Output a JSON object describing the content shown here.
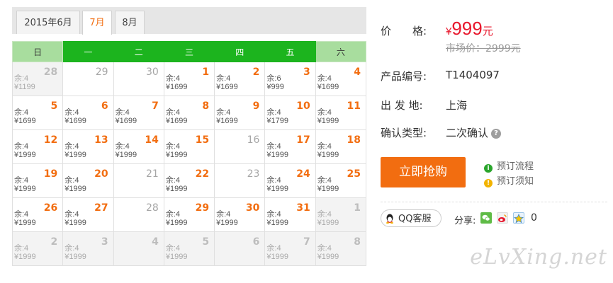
{
  "tabs": [
    "2015年6月",
    "7月",
    "8月"
  ],
  "weekdays": [
    "日",
    "一",
    "二",
    "三",
    "四",
    "五",
    "六"
  ],
  "weeks": [
    [
      {
        "day": "28",
        "rem": "余:4",
        "price": "¥1199",
        "state": "off"
      },
      {
        "day": "29",
        "rem": "",
        "price": "",
        "state": "sold"
      },
      {
        "day": "30",
        "rem": "",
        "price": "",
        "state": "sold"
      },
      {
        "day": "1",
        "rem": "余:4",
        "price": "¥1699",
        "state": "on"
      },
      {
        "day": "2",
        "rem": "余:4",
        "price": "¥1699",
        "state": "on"
      },
      {
        "day": "3",
        "rem": "余:6",
        "price": "¥999",
        "state": "on"
      },
      {
        "day": "4",
        "rem": "余:4",
        "price": "¥1699",
        "state": "on"
      }
    ],
    [
      {
        "day": "5",
        "rem": "余:4",
        "price": "¥1699",
        "state": "on"
      },
      {
        "day": "6",
        "rem": "余:4",
        "price": "¥1699",
        "state": "on"
      },
      {
        "day": "7",
        "rem": "余:4",
        "price": "¥1699",
        "state": "on"
      },
      {
        "day": "8",
        "rem": "余:4",
        "price": "¥1699",
        "state": "on"
      },
      {
        "day": "9",
        "rem": "余:4",
        "price": "¥1699",
        "state": "on"
      },
      {
        "day": "10",
        "rem": "余:4",
        "price": "¥1799",
        "state": "on"
      },
      {
        "day": "11",
        "rem": "余:4",
        "price": "¥1999",
        "state": "on"
      }
    ],
    [
      {
        "day": "12",
        "rem": "余:4",
        "price": "¥1999",
        "state": "on"
      },
      {
        "day": "13",
        "rem": "余:4",
        "price": "¥1999",
        "state": "on"
      },
      {
        "day": "14",
        "rem": "余:4",
        "price": "¥1999",
        "state": "on"
      },
      {
        "day": "15",
        "rem": "余:4",
        "price": "¥1999",
        "state": "on"
      },
      {
        "day": "16",
        "rem": "",
        "price": "",
        "state": "sold"
      },
      {
        "day": "17",
        "rem": "余:4",
        "price": "¥1999",
        "state": "on"
      },
      {
        "day": "18",
        "rem": "余:4",
        "price": "¥1999",
        "state": "on"
      }
    ],
    [
      {
        "day": "19",
        "rem": "余:4",
        "price": "¥1999",
        "state": "on"
      },
      {
        "day": "20",
        "rem": "余:4",
        "price": "¥1999",
        "state": "on"
      },
      {
        "day": "21",
        "rem": "",
        "price": "",
        "state": "sold"
      },
      {
        "day": "22",
        "rem": "余:4",
        "price": "¥1999",
        "state": "on"
      },
      {
        "day": "23",
        "rem": "",
        "price": "",
        "state": "sold"
      },
      {
        "day": "24",
        "rem": "余:4",
        "price": "¥1999",
        "state": "on"
      },
      {
        "day": "25",
        "rem": "余:4",
        "price": "¥1999",
        "state": "on"
      }
    ],
    [
      {
        "day": "26",
        "rem": "余:4",
        "price": "¥1999",
        "state": "on"
      },
      {
        "day": "27",
        "rem": "余:4",
        "price": "¥1999",
        "state": "on"
      },
      {
        "day": "28",
        "rem": "",
        "price": "",
        "state": "sold"
      },
      {
        "day": "29",
        "rem": "余:4",
        "price": "¥1999",
        "state": "on"
      },
      {
        "day": "30",
        "rem": "余:4",
        "price": "¥1999",
        "state": "on"
      },
      {
        "day": "31",
        "rem": "余:4",
        "price": "¥1999",
        "state": "on"
      },
      {
        "day": "1",
        "rem": "余:4",
        "price": "¥1999",
        "state": "off"
      }
    ],
    [
      {
        "day": "2",
        "rem": "余:4",
        "price": "¥1999",
        "state": "off"
      },
      {
        "day": "3",
        "rem": "余:4",
        "price": "¥1999",
        "state": "off"
      },
      {
        "day": "4",
        "rem": "",
        "price": "",
        "state": "off"
      },
      {
        "day": "5",
        "rem": "余:4",
        "price": "¥1999",
        "state": "off"
      },
      {
        "day": "6",
        "rem": "",
        "price": "",
        "state": "off"
      },
      {
        "day": "7",
        "rem": "余:4",
        "price": "¥1999",
        "state": "off"
      },
      {
        "day": "8",
        "rem": "余:4",
        "price": "¥1999",
        "state": "off"
      }
    ]
  ],
  "product": {
    "price_label": "价　　格:",
    "price_currency": "¥",
    "price_amount": "999",
    "price_unit": "元",
    "market_price": "市场价：2999元",
    "code_label": "产品编号:",
    "code_value": "T1404097",
    "depart_label": "出 发 地:",
    "depart_value": "上海",
    "confirm_label": "确认类型:",
    "confirm_value": "二次确认",
    "help_glyph": "?",
    "buy_label": "立即抢购",
    "flow_link": "预订流程",
    "notice_link": "预订须知",
    "flow_glyph": "i",
    "notice_glyph": "!"
  },
  "share": {
    "qq_label": "QQ客服",
    "share_label": "分享:",
    "count": "0",
    "icons": [
      "wechat-icon",
      "weibo-icon",
      "qzone-icon"
    ]
  },
  "watermark": "eLvXing.net",
  "colors": {
    "accent": "#f26d10",
    "weekday_header": "#1cb41e",
    "weekend_header": "#a8dd9e",
    "price_red": "#e8172c"
  }
}
